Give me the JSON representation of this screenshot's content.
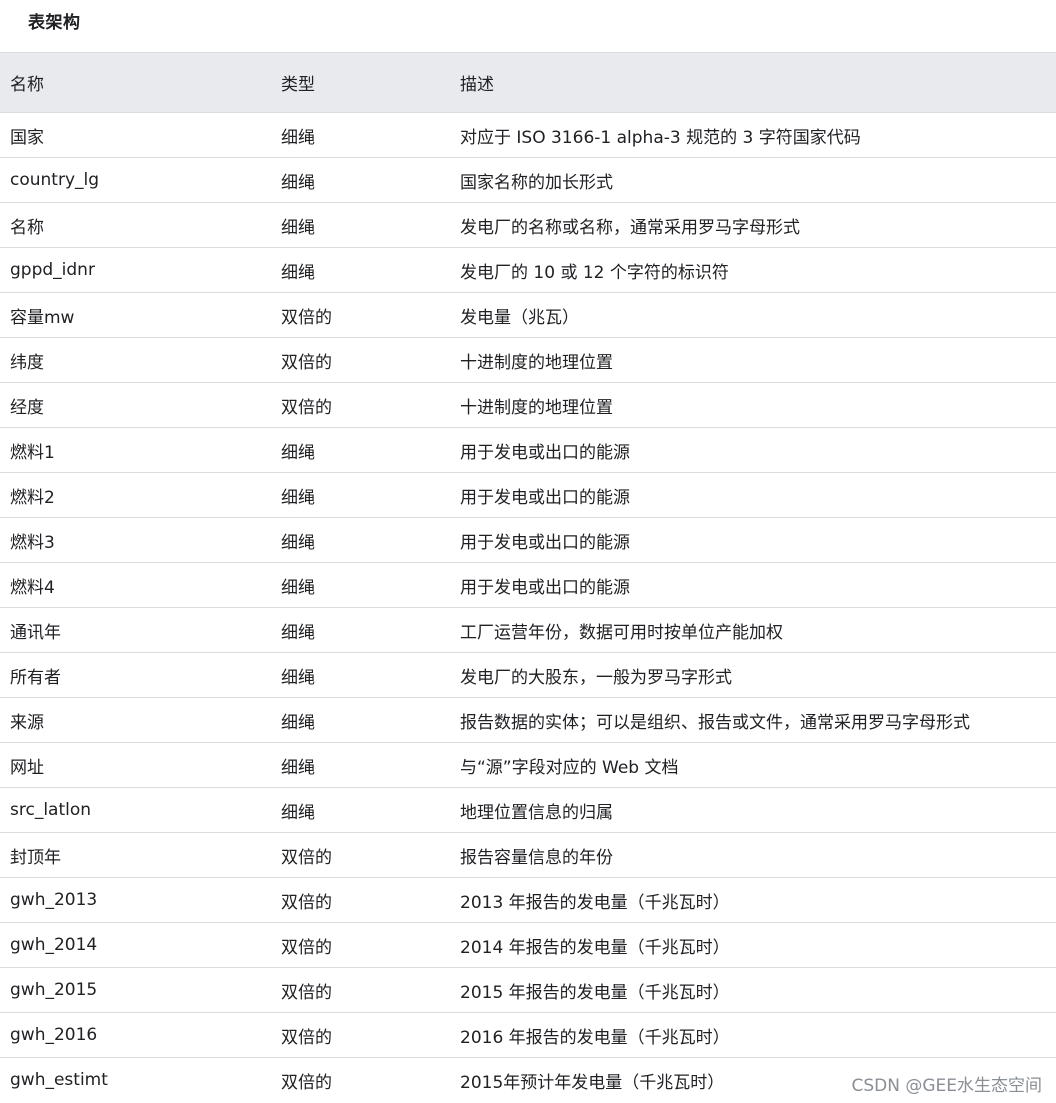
{
  "section_title": "表架构",
  "table": {
    "headers": [
      "名称",
      "类型",
      "描述"
    ],
    "rows": [
      [
        "国家",
        "细绳",
        "对应于 ISO 3166-1 alpha-3 规范的 3 字符国家代码"
      ],
      [
        "country_lg",
        "细绳",
        "国家名称的加长形式"
      ],
      [
        "名称",
        "细绳",
        "发电厂的名称或名称，通常采用罗马字母形式"
      ],
      [
        "gppd_idnr",
        "细绳",
        "发电厂的 10 或 12 个字符的标识符"
      ],
      [
        "容量mw",
        "双倍的",
        "发电量（兆瓦）"
      ],
      [
        "纬度",
        "双倍的",
        "十进制度的地理位置"
      ],
      [
        "经度",
        "双倍的",
        "十进制度的地理位置"
      ],
      [
        "燃料1",
        "细绳",
        "用于发电或出口的能源"
      ],
      [
        "燃料2",
        "细绳",
        "用于发电或出口的能源"
      ],
      [
        "燃料3",
        "细绳",
        "用于发电或出口的能源"
      ],
      [
        "燃料4",
        "细绳",
        "用于发电或出口的能源"
      ],
      [
        "通讯年",
        "细绳",
        "工厂运营年份，数据可用时按单位产能加权"
      ],
      [
        "所有者",
        "细绳",
        "发电厂的大股东，一般为罗马字形式"
      ],
      [
        "来源",
        "细绳",
        "报告数据的实体；可以是组织、报告或文件，通常采用罗马字母形式"
      ],
      [
        "网址",
        "细绳",
        "与“源”字段对应的 Web 文档"
      ],
      [
        "src_latlon",
        "细绳",
        "地理位置信息的归属"
      ],
      [
        "封顶年",
        "双倍的",
        "报告容量信息的年份"
      ],
      [
        "gwh_2013",
        "双倍的",
        "2013 年报告的发电量（千兆瓦时）"
      ],
      [
        "gwh_2014",
        "双倍的",
        "2014 年报告的发电量（千兆瓦时）"
      ],
      [
        "gwh_2015",
        "双倍的",
        "2015 年报告的发电量（千兆瓦时）"
      ],
      [
        "gwh_2016",
        "双倍的",
        "2016 年报告的发电量（千兆瓦时）"
      ],
      [
        "gwh_estimt",
        "双倍的",
        "2015年预计年发电量（千兆瓦时）"
      ]
    ]
  },
  "watermark": "CSDN @GEE水生态空间"
}
